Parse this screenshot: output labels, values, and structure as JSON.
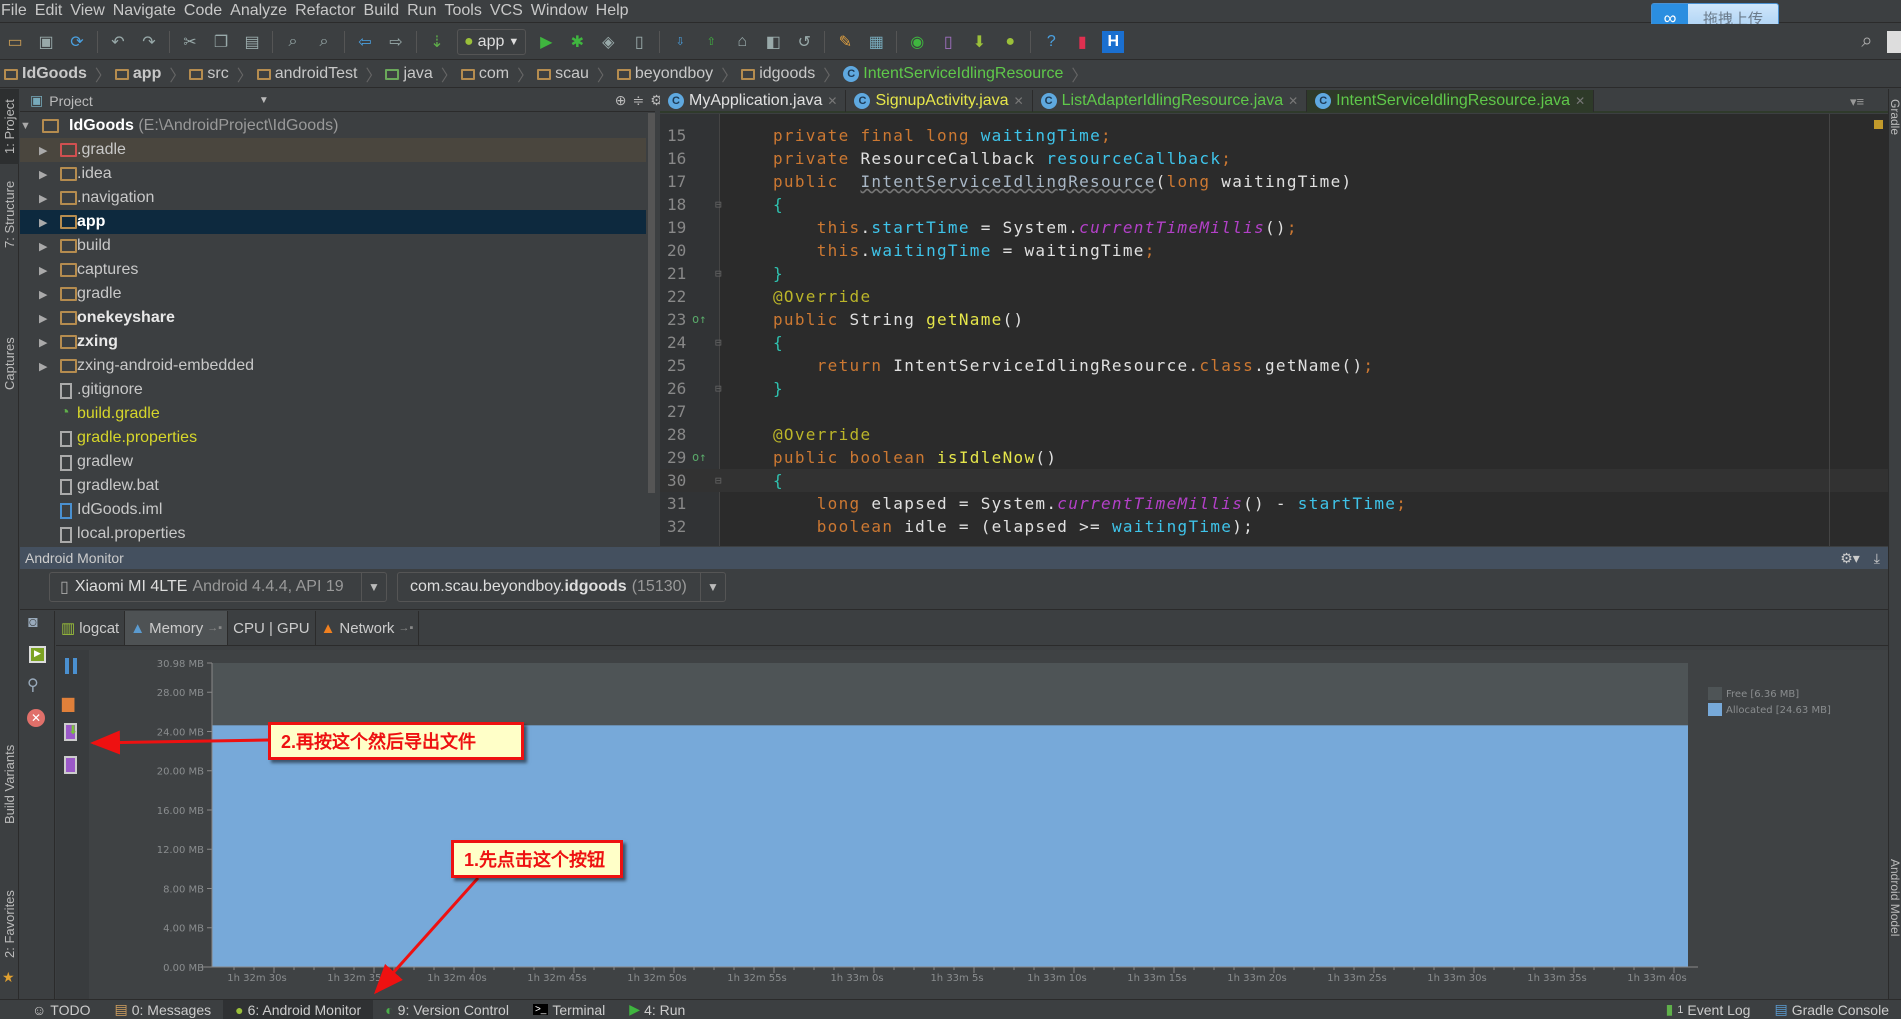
{
  "menu": [
    "File",
    "Edit",
    "View",
    "Navigate",
    "Code",
    "Analyze",
    "Refactor",
    "Build",
    "Run",
    "Tools",
    "VCS",
    "Window",
    "Help"
  ],
  "upload_widget": {
    "label": "拖拽上传"
  },
  "toolbar": {
    "run_config": "app"
  },
  "breadcrumb": [
    "IdGoods",
    "app",
    "src",
    "androidTest",
    "java",
    "com",
    "scau",
    "beyondboy",
    "idgoods",
    "IntentServiceIdlingResource"
  ],
  "left_stripe": [
    "1: Project",
    "7: Structure",
    "Captures",
    "Build Variants",
    "2: Favorites"
  ],
  "right_stripe": [
    "Gradle",
    "Android Model"
  ],
  "project": {
    "header": "Project",
    "root": {
      "name": "IdGoods",
      "path": "(E:\\AndroidProject\\IdGoods)"
    },
    "items": [
      {
        "name": ".gradle",
        "type": "folder",
        "color": "#c8c8c8",
        "bold": false,
        "excluded": true
      },
      {
        "name": ".idea",
        "type": "folder",
        "color": "#c8c8c8",
        "bold": false
      },
      {
        "name": ".navigation",
        "type": "folder",
        "color": "#c8c8c8",
        "bold": false
      },
      {
        "name": "app",
        "type": "module",
        "color": "#ffffff",
        "bold": true,
        "selected": true
      },
      {
        "name": "build",
        "type": "folder",
        "color": "#c8c8c8",
        "bold": false
      },
      {
        "name": "captures",
        "type": "folder",
        "color": "#c8c8c8",
        "bold": false
      },
      {
        "name": "gradle",
        "type": "folder",
        "color": "#c8c8c8",
        "bold": false
      },
      {
        "name": "onekeyshare",
        "type": "module",
        "color": "#e8e8e8",
        "bold": true
      },
      {
        "name": "zxing",
        "type": "module",
        "color": "#e8e8e8",
        "bold": true
      },
      {
        "name": "zxing-android-embedded",
        "type": "folder",
        "color": "#c8c8c8",
        "bold": false
      },
      {
        "name": ".gitignore",
        "type": "file",
        "color": "#c8c8c8",
        "bold": false
      },
      {
        "name": "build.gradle",
        "type": "gradle",
        "color": "#d6d62b",
        "bold": false
      },
      {
        "name": "gradle.properties",
        "type": "props",
        "color": "#d6d62b",
        "bold": false
      },
      {
        "name": "gradlew",
        "type": "file",
        "color": "#c8c8c8",
        "bold": false
      },
      {
        "name": "gradlew.bat",
        "type": "file",
        "color": "#c8c8c8",
        "bold": false
      },
      {
        "name": "IdGoods.iml",
        "type": "iml",
        "color": "#c8c8c8",
        "bold": false
      },
      {
        "name": "local.properties",
        "type": "props",
        "color": "#c8c8c8",
        "bold": false
      }
    ]
  },
  "editor": {
    "tabs": [
      {
        "label": "MyApplication.java",
        "color": "#e0e0e0"
      },
      {
        "label": "SignupActivity.java",
        "color": "#e6e64a"
      },
      {
        "label": "ListAdapterIdlingResource.java",
        "color": "#5fc84a"
      },
      {
        "label": "IntentServiceIdlingResource.java",
        "color": "#5fc84a",
        "active": true
      }
    ],
    "lines": [
      {
        "n": "15",
        "t": [
          [
            "private ",
            "kw"
          ],
          [
            "final ",
            "kw"
          ],
          [
            "long ",
            "kw"
          ],
          [
            "waitingTime",
            "fd"
          ],
          [
            ";",
            "kw"
          ]
        ]
      },
      {
        "n": "16",
        "t": [
          [
            "private ",
            "kw"
          ],
          [
            "ResourceCallback ",
            "pl"
          ],
          [
            "resourceCallback",
            "fd"
          ],
          [
            ";",
            "kw"
          ]
        ]
      },
      {
        "n": "17",
        "t": [
          [
            "public  ",
            "kw"
          ],
          [
            "IntentServiceIdlingResource",
            "cls"
          ],
          [
            "(",
            "pl"
          ],
          [
            "long ",
            "kw"
          ],
          [
            "waitingTime)",
            "pl"
          ]
        ]
      },
      {
        "n": "18",
        "t": [
          [
            "{",
            "br"
          ]
        ],
        "fold": true
      },
      {
        "n": "19",
        "t": [
          [
            "    this",
            "kw"
          ],
          [
            ".",
            "pl"
          ],
          [
            "startTime",
            "fd"
          ],
          [
            " = System.",
            "pl"
          ],
          [
            "currentTimeMillis",
            "st"
          ],
          [
            "()",
            "pl"
          ],
          [
            ";",
            "kw"
          ]
        ]
      },
      {
        "n": "20",
        "t": [
          [
            "    this",
            "kw"
          ],
          [
            ".",
            "pl"
          ],
          [
            "waitingTime",
            "fd"
          ],
          [
            " = waitingTime",
            "pl"
          ],
          [
            ";",
            "kw"
          ]
        ]
      },
      {
        "n": "21",
        "t": [
          [
            "}",
            "br"
          ]
        ],
        "fold": true
      },
      {
        "n": "22",
        "t": [
          [
            "@Override",
            "an"
          ]
        ]
      },
      {
        "n": "23",
        "t": [
          [
            "public ",
            "kw"
          ],
          [
            "String ",
            "pl"
          ],
          [
            "getName",
            "mt"
          ],
          [
            "()",
            "pl"
          ]
        ],
        "mark": true
      },
      {
        "n": "24",
        "t": [
          [
            "{",
            "br"
          ]
        ],
        "fold": true
      },
      {
        "n": "25",
        "t": [
          [
            "    return ",
            "kw"
          ],
          [
            "IntentServiceIdlingResource.",
            "pl"
          ],
          [
            "class",
            "kw"
          ],
          [
            ".getName()",
            "pl"
          ],
          [
            ";",
            "kw"
          ]
        ]
      },
      {
        "n": "26",
        "t": [
          [
            "}",
            "br"
          ]
        ],
        "fold": true
      },
      {
        "n": "27",
        "t": []
      },
      {
        "n": "28",
        "t": [
          [
            "@Override",
            "an"
          ]
        ]
      },
      {
        "n": "29",
        "t": [
          [
            "public ",
            "kw"
          ],
          [
            "boolean ",
            "kw"
          ],
          [
            "isIdleNow",
            "mt"
          ],
          [
            "()",
            "pl"
          ]
        ],
        "mark": true
      },
      {
        "n": "30",
        "t": [
          [
            "{",
            "br"
          ]
        ],
        "fold": true,
        "current": true
      },
      {
        "n": "31",
        "t": [
          [
            "    long ",
            "kw"
          ],
          [
            "elapsed = System.",
            "pl"
          ],
          [
            "currentTimeMillis",
            "st"
          ],
          [
            "() - ",
            "pl"
          ],
          [
            "startTime",
            "fd"
          ],
          [
            ";",
            "kw"
          ]
        ]
      },
      {
        "n": "32",
        "t": [
          [
            "    boolean ",
            "kw"
          ],
          [
            "idle = (elapsed >= ",
            "pl"
          ],
          [
            "waitingTime",
            "fd"
          ],
          [
            ");",
            "pl"
          ]
        ]
      }
    ]
  },
  "monitor": {
    "title": "Android Monitor",
    "device": {
      "name": "Xiaomi MI 4LTE",
      "detail": "Android 4.4.4, API 19"
    },
    "process": {
      "prefix": "com.scau.beyondboy.",
      "name": "idgoods",
      "pid": "(15130)"
    },
    "tabs": [
      "logcat",
      "Memory",
      "CPU | GPU",
      "Network"
    ],
    "active_tab": "Memory"
  },
  "chart_data": {
    "type": "area",
    "ylim": [
      0,
      30.98
    ],
    "y_ticks": [
      0,
      4,
      8,
      12,
      16,
      20,
      24,
      28,
      30.98
    ],
    "y_tick_labels": [
      "0.00 MB",
      "4.00 MB",
      "8.00 MB",
      "12.00 MB",
      "16.00 MB",
      "20.00 MB",
      "24.00 MB",
      "28.00 MB",
      "30.98 MB"
    ],
    "x_tick_labels": [
      "1h 32m 30s",
      "1h 32m 35s",
      "1h 32m 40s",
      "1h 32m 45s",
      "1h 32m 50s",
      "1h 32m 55s",
      "1h 33m 0s",
      "1h 33m 5s",
      "1h 33m 10s",
      "1h 33m 15s",
      "1h 33m 20s",
      "1h 33m 25s",
      "1h 33m 30s",
      "1h 33m 35s",
      "1h 33m 40s"
    ],
    "series": [
      {
        "name": "Free [6.36 MB]",
        "value": 6.36,
        "color": "#4e5456"
      },
      {
        "name": "Allocated [24.63 MB]",
        "value": 24.63,
        "color": "#77a9d9"
      }
    ],
    "legend": "top-right"
  },
  "annotations": {
    "step1": "1.先点击这个按钮",
    "step2": "2.再按这个然后导出文件"
  },
  "statusbar": {
    "left": [
      {
        "label": "TODO"
      },
      {
        "label": "0: Messages"
      },
      {
        "label": "6: Android Monitor",
        "active": true
      },
      {
        "label": "9: Version Control"
      },
      {
        "label": "Terminal"
      },
      {
        "label": "4: Run"
      }
    ],
    "event_log": {
      "count": "1",
      "label": "Event Log"
    },
    "gradle_console": "Gradle Console"
  }
}
